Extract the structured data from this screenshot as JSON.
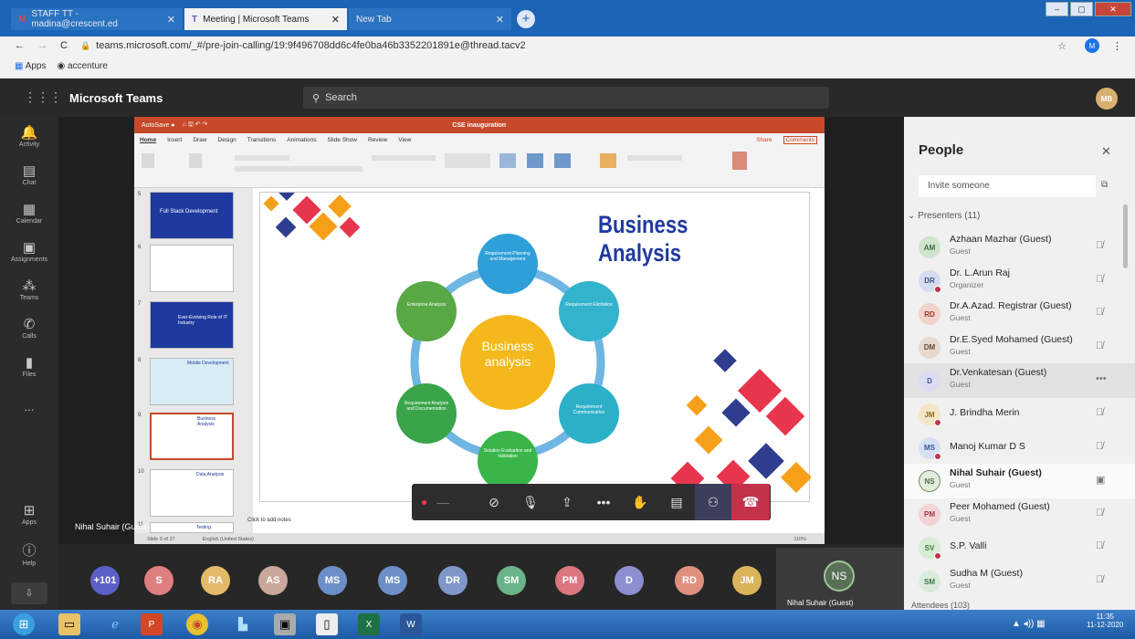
{
  "browser": {
    "tabs": [
      {
        "label": "STAFF TT - madina@crescent.ed",
        "close": "✕"
      },
      {
        "label": "Meeting | Microsoft Teams",
        "close": "✕"
      },
      {
        "label": "New Tab",
        "close": "✕"
      }
    ],
    "new_tab": "+",
    "url": "teams.microsoft.com/_#/pre-join-calling/19:9f496708dd6c4fe0ba46b3352201891e@thread.tacv2",
    "bookmarks": [
      "Apps",
      "accenture"
    ]
  },
  "teams": {
    "app_title": "Microsoft Teams",
    "search_placeholder": "Search",
    "user_avatar": "MB",
    "rail": [
      {
        "label": "Activity",
        "icon": "bell-icon"
      },
      {
        "label": "Chat",
        "icon": "chat-icon"
      },
      {
        "label": "Calendar",
        "icon": "calendar-icon"
      },
      {
        "label": "Assignments",
        "icon": "assignments-icon"
      },
      {
        "label": "Teams",
        "icon": "teams-icon"
      },
      {
        "label": "Calls",
        "icon": "phone-icon"
      },
      {
        "label": "Files",
        "icon": "files-icon"
      },
      {
        "label": "...",
        "icon": "more-icon"
      },
      {
        "label": "Apps",
        "icon": "apps-icon"
      },
      {
        "label": "Help",
        "icon": "help-icon"
      }
    ]
  },
  "ppt": {
    "title": "CSE inauguration",
    "tabs": [
      "Home",
      "Insert",
      "Draw",
      "Design",
      "Transitions",
      "Animations",
      "Slide Show",
      "Review",
      "View"
    ],
    "share": "Share",
    "comments": "Comments",
    "thumbnails": [
      {
        "num": "5",
        "text": "Full Stack Development"
      },
      {
        "num": "6",
        "text": ""
      },
      {
        "num": "7",
        "text": "Ever-Evolving Role of IT Industry"
      },
      {
        "num": "8",
        "text": "Mobile Development"
      },
      {
        "num": "9",
        "text": "Business Analysis"
      },
      {
        "num": "10",
        "text": "Data Analysis"
      },
      {
        "num": "11",
        "text": "Testing"
      }
    ],
    "notes": "Click to add notes",
    "status": [
      "Slide 9 of 27",
      "English (United States)"
    ],
    "zoom": "110%",
    "presenter": "Nihal Suhair (Guest)"
  },
  "slide": {
    "title": "Business Analysis",
    "center": [
      "Business",
      "analysis"
    ],
    "nodes": [
      {
        "text": "Requirement Planning and Management",
        "color": "#2e9fd8"
      },
      {
        "text": "Requirement Elicitation",
        "color": "#33b3cc"
      },
      {
        "text": "Requirement Communication",
        "color": "#2bb0c8"
      },
      {
        "text": "Solution Evaluation and Validation",
        "color": "#39b54a"
      },
      {
        "text": "Requirement Analysis and Documentation",
        "color": "#3aa44a"
      },
      {
        "text": "Enterprise Analysis",
        "color": "#58a845"
      }
    ]
  },
  "participants_strip": [
    {
      "label": "+101",
      "color": "#5b5fc7"
    },
    {
      "label": "S",
      "color": "#e07f7f"
    },
    {
      "label": "RA",
      "color": "#e3b96a"
    },
    {
      "label": "AS",
      "color": "#c9a79a"
    },
    {
      "label": "MS",
      "color": "#6d8fc7"
    },
    {
      "label": "MS",
      "color": "#6d8fc7"
    },
    {
      "label": "DR",
      "color": "#7f97c9"
    },
    {
      "label": "SM",
      "color": "#6ab48a"
    },
    {
      "label": "PM",
      "color": "#d9767f"
    },
    {
      "label": "D",
      "color": "#8c8fcf"
    },
    {
      "label": "RD",
      "color": "#e08f7f"
    },
    {
      "label": "JM",
      "color": "#d9b45a"
    }
  ],
  "self_tile": {
    "initials": "NS",
    "name": "Nihal Suhair (Guest)"
  },
  "people": {
    "title": "People",
    "invite_placeholder": "Invite someone",
    "section": "Presenters (11)",
    "attendees_section": "Attendees (103)",
    "list": [
      {
        "initials": "AM",
        "name": "Azhaan Mazhar (Guest)",
        "role": "Guest",
        "bg": "#cfe3cf",
        "fg": "#3c6e3c",
        "dot": false
      },
      {
        "initials": "DR",
        "name": "Dr. L.Arun Raj",
        "role": "Organizer",
        "bg": "#d6dcef",
        "fg": "#42508a",
        "dot": true
      },
      {
        "initials": "RD",
        "name": "Dr.A.Azad. Registrar (Guest)",
        "role": "Guest",
        "bg": "#f2d4cf",
        "fg": "#9b3a2b",
        "dot": false
      },
      {
        "initials": "DM",
        "name": "Dr.E.Syed Mohamed (Guest)",
        "role": "Guest",
        "bg": "#e6d9d0",
        "fg": "#6b4a33",
        "dot": false
      },
      {
        "initials": "D",
        "name": "Dr.Venkatesan (Guest)",
        "role": "Guest",
        "bg": "#dcdcf2",
        "fg": "#4b4f9a",
        "dot": false
      },
      {
        "initials": "JM",
        "name": "J. Brindha Merin",
        "role": "",
        "bg": "#f2e6c6",
        "fg": "#8a6a1f",
        "dot": true
      },
      {
        "initials": "MS",
        "name": "Manoj Kumar D S",
        "role": "",
        "bg": "#d6e0f2",
        "fg": "#3a5a9a",
        "dot": true
      },
      {
        "initials": "NS",
        "name": "Nihal Suhair (Guest)",
        "role": "Guest",
        "bg": "#e3ecdf",
        "fg": "#4d6e46",
        "dot": false
      },
      {
        "initials": "PM",
        "name": "Peer Mohamed (Guest)",
        "role": "Guest",
        "bg": "#f2d4d6",
        "fg": "#9a3a44",
        "dot": false
      },
      {
        "initials": "SV",
        "name": "S.P. Valli",
        "role": "",
        "bg": "#d9ecd6",
        "fg": "#3c7a3c",
        "dot": true
      },
      {
        "initials": "SM",
        "name": "Sudha M (Guest)",
        "role": "Guest",
        "bg": "#d9ecdc",
        "fg": "#3c7a4c",
        "dot": false
      }
    ]
  },
  "taskbar": {
    "time": "11:35",
    "date": "11-12-2020"
  }
}
